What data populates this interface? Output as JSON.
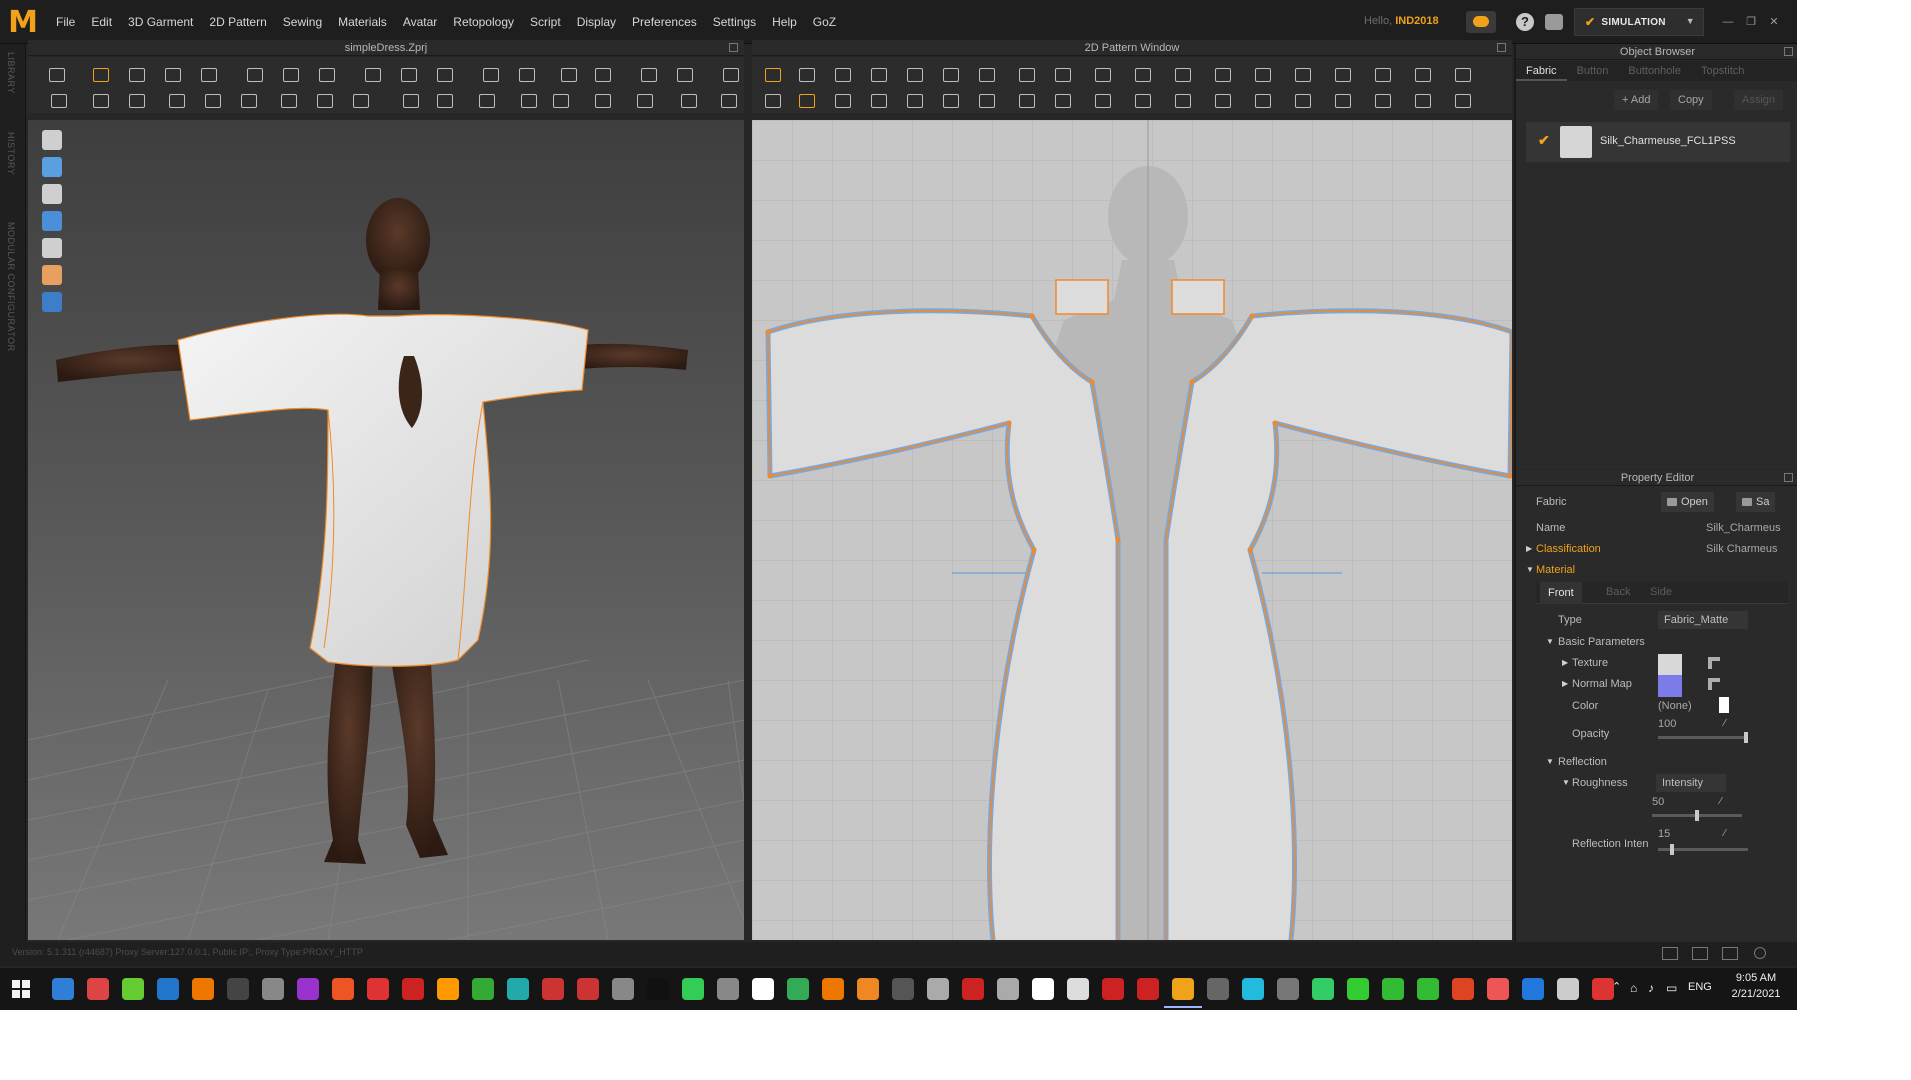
{
  "menubar": {
    "logo": "M",
    "menus": [
      "File",
      "Edit",
      "3D Garment",
      "2D Pattern",
      "Sewing",
      "Materials",
      "Avatar",
      "Retopology",
      "Script",
      "Display",
      "Preferences",
      "Settings",
      "Help",
      "GoZ"
    ],
    "greeting": "Hello,",
    "username": "IND2018",
    "simulation_label": "SIMULATION"
  },
  "left_dock": {
    "labels": [
      "LIBRARY",
      "HISTORY",
      "MODULAR CONFIGURATOR"
    ]
  },
  "viewport3d": {
    "title": "simpleDress.Zprj"
  },
  "viewport2d": {
    "title": "2D Pattern Window"
  },
  "object_browser": {
    "title": "Object Browser",
    "tabs": [
      "Fabric",
      "Button",
      "Buttonhole",
      "Topstitch"
    ],
    "add_label": "+ Add",
    "copy_label": "Copy",
    "assign_label": "Assign",
    "fabric_name": "Silk_Charmeuse_FCL1PSS"
  },
  "property_editor": {
    "title": "Property Editor",
    "fabric_label": "Fabric",
    "open_label": "Open",
    "save_label": "Sa",
    "name_label": "Name",
    "name_value": "Silk_Charmeus",
    "classification_label": "Classification",
    "classification_value": "Silk Charmeus",
    "material_label": "Material",
    "material_tabs": [
      "Front",
      "Back",
      "Side"
    ],
    "type_label": "Type",
    "type_value": "Fabric_Matte",
    "basic_parameters_label": "Basic Parameters",
    "texture_label": "Texture",
    "normal_map_label": "Normal Map",
    "color_label": "Color",
    "color_value": "(None)",
    "opacity_label": "Opacity",
    "opacity_value": "100",
    "reflection_label": "Reflection",
    "roughness_label": "Roughness",
    "roughness_mode": "Intensity",
    "roughness_value": "50",
    "reflection_intensity_label": "Reflection Inten",
    "reflection_intensity_value": "15",
    "swatch_colors": {
      "texture": "#d8d8d8",
      "normal_map": "#7b7bea",
      "color": "#ffffff"
    }
  },
  "statusbar": {
    "text": "Version: 5.1.311 (r44687)   Proxy Server:127.0.0.1, Public IP:, Proxy Type:PROXY_HTTP"
  },
  "taskbar": {
    "language": "ENG",
    "time": "9:05 AM",
    "date": "2/21/2021"
  },
  "colors": {
    "accent": "#f0a21a",
    "seam_orange": "#f08a28",
    "seam_blue": "#7fa6d6",
    "pattern_fill": "#dcdcdc"
  }
}
